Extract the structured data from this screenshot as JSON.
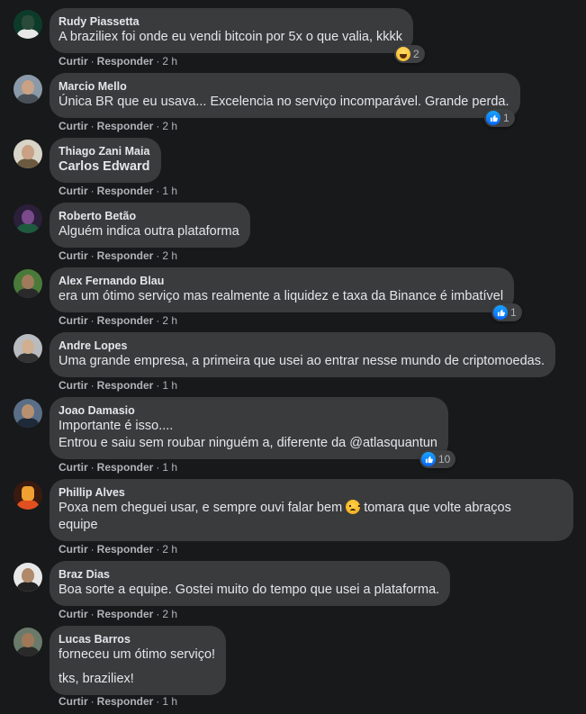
{
  "actions": {
    "like": "Curtir",
    "reply": "Responder",
    "separator": "·"
  },
  "comments": [
    {
      "author": "Rudy Piassetta",
      "lines": [
        "A braziliex foi onde eu vendi bitcoin por 5x o que valia, kkkk"
      ],
      "time": "2 h",
      "reaction": {
        "icon": "haha-icon",
        "count": "2"
      }
    },
    {
      "author": "Marcio Mello",
      "lines": [
        "Única BR que eu usava... Excelencia no serviço incomparável. Grande perda."
      ],
      "time": "2 h",
      "reaction": {
        "icon": "like-icon",
        "count": "1"
      }
    },
    {
      "author": "Thiago Zani Maia",
      "lines": [
        "Carlos Edward"
      ],
      "time": "1 h"
    },
    {
      "author": "Roberto Betão",
      "lines": [
        "Alguém indica outra plataforma"
      ],
      "time": "2 h"
    },
    {
      "author": "Alex Fernando Blau",
      "lines": [
        "era um ótimo serviço mas realmente a liquidez e taxa da Binance é imbatível"
      ],
      "time": "2 h",
      "reaction": {
        "icon": "like-icon",
        "count": "1"
      }
    },
    {
      "author": "Andre Lopes",
      "lines": [
        "Uma grande empresa, a primeira que usei ao entrar nesse mundo de criptomoedas."
      ],
      "time": "1 h"
    },
    {
      "author": "Joao Damasio",
      "lines": [
        "Importante é isso....",
        "Entrou e saiu sem roubar ninguém a, diferente da @atlasquantun"
      ],
      "time": "1 h",
      "reaction": {
        "icon": "like-icon",
        "count": "10"
      }
    },
    {
      "author": "Phillip Alves",
      "lines": [
        "Poxa nem cheguei usar, e sempre ouvi falar bem",
        "tomara que volte abraços",
        "equipe"
      ],
      "emoji": "sad-icon",
      "time": "2 h"
    },
    {
      "author": "Braz Dias",
      "lines": [
        "Boa sorte a equipe. Gostei muito do tempo que usei a plataforma."
      ],
      "time": "2 h"
    },
    {
      "author": "Lucas Barros",
      "lines": [
        "forneceu um ótimo serviço!",
        "tks, braziliex!"
      ],
      "time": "1 h"
    }
  ]
}
